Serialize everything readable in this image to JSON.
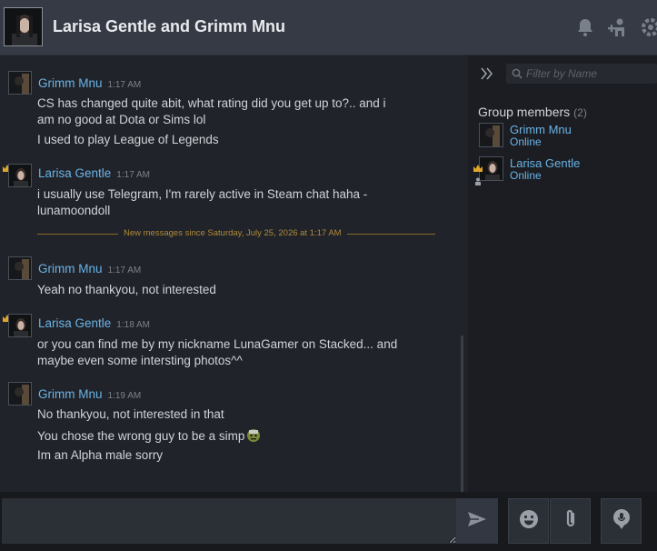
{
  "header": {
    "title": "Larisa Gentle and Grimm Mnu",
    "icons": [
      "bell-icon",
      "add-friend-icon",
      "settings-gear-icon"
    ]
  },
  "messages": [
    {
      "sender": "Grimm Mnu",
      "time": "1:17 AM",
      "lines": [
        "CS has changed quite abit, what rating did you get up to?.. and i",
        "am no good at Dota or Sims lol",
        "I used to play League of Legends"
      ]
    },
    {
      "sender": "Larisa Gentle",
      "time": "1:17 AM",
      "lines": [
        "i usually use Telegram, I'm rarely active in Steam chat haha -",
        "lunamoondoll"
      ]
    },
    {
      "sender": "Grimm Mnu",
      "time": "1:17 AM",
      "lines": [
        "Yeah no thankyou, not interested"
      ]
    },
    {
      "sender": "Larisa Gentle",
      "time": "1:18 AM",
      "lines": [
        "or you can find me by my nickname LunaGamer on Stacked... and",
        "maybe even some intersting photos^^"
      ]
    },
    {
      "sender": "Grimm Mnu",
      "time": "1:19 AM",
      "lines": [
        "No thankyou, not interested in that",
        "You chose the wrong guy to be a simp",
        "Im an Alpha male sorry"
      ]
    }
  ],
  "divider_text": "New messages since Saturday, July 25, 2026 at 1:17 AM",
  "sidebar": {
    "filter_placeholder": "Filter by Name",
    "group_title": "Group members",
    "group_count": "(2)",
    "members": [
      {
        "name": "Grimm Mnu",
        "status": "Online"
      },
      {
        "name": "Larisa Gentle",
        "status": "Online"
      }
    ]
  },
  "composer": {
    "value": "",
    "buttons": [
      "send-icon",
      "emoticon-icon",
      "attach-icon",
      "voice-icon"
    ]
  },
  "colors": {
    "name_blue": "#6ab3e6",
    "divider_gold": "#b08a3a",
    "header_bg": "#353a44"
  }
}
